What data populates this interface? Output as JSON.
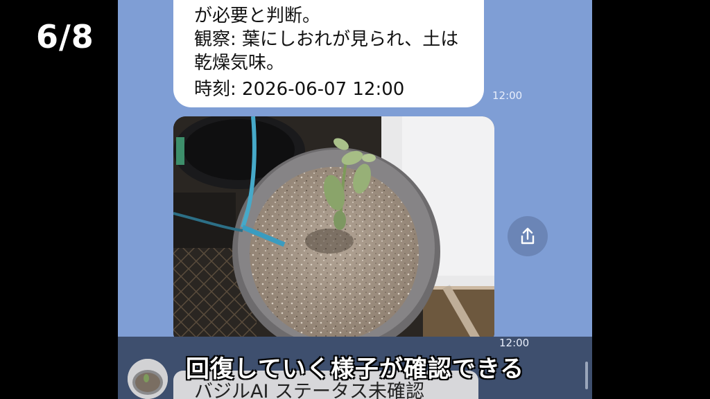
{
  "overlay": {
    "page_counter": "6/8",
    "subtitle": "回復していく様子が確認できる"
  },
  "chat": {
    "message": {
      "lines": [
        "が必要と判断。",
        "観察: 葉にしおれが見られ、土は",
        "乾燥気味。",
        "時刻: 2026-06-07 12:00"
      ],
      "time": "12:00"
    },
    "photo_message": {
      "time": "12:00"
    },
    "status_message": {
      "text": "バジルAI ステータス未確認"
    },
    "share_icon": "share-icon"
  },
  "colors": {
    "chat_background": "#7f9ed5",
    "bubble": "#ffffff",
    "bottom_bar": "#3e4f6e"
  }
}
